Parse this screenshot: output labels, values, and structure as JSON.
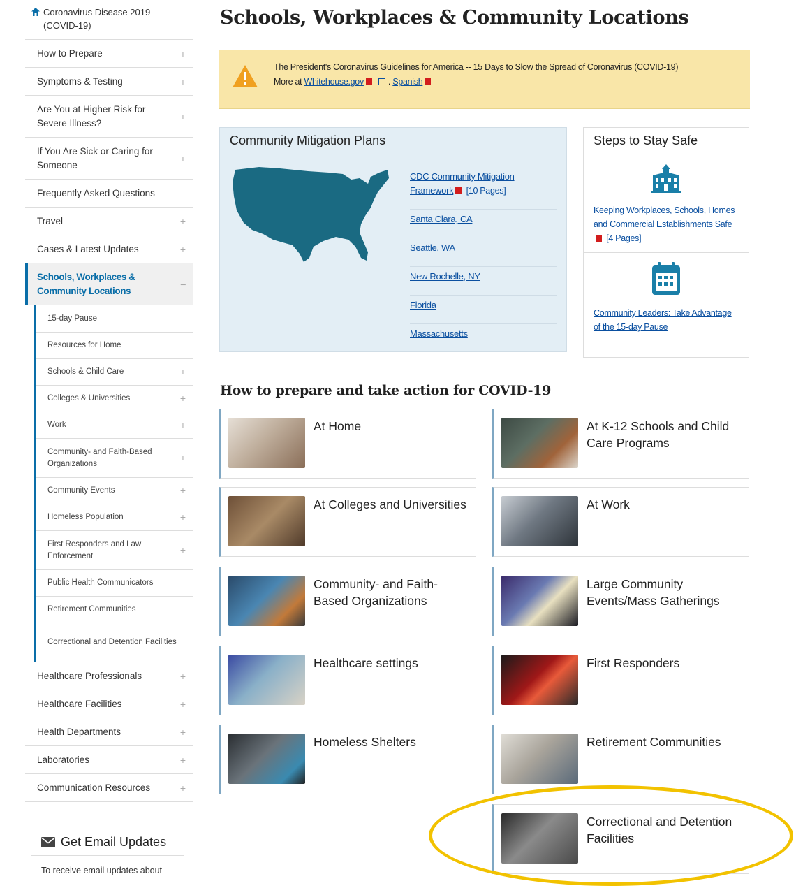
{
  "sidebar": {
    "home": "Coronavirus Disease 2019 (COVID-19)",
    "items": [
      {
        "label": "How to Prepare",
        "expand": "+"
      },
      {
        "label": "Symptoms & Testing",
        "expand": "+"
      },
      {
        "label": "Are You at Higher Risk for Severe Illness?",
        "expand": "+"
      },
      {
        "label": "If You Are Sick or Caring for Someone",
        "expand": "+"
      },
      {
        "label": "Frequently Asked Questions",
        "expand": ""
      },
      {
        "label": "Travel",
        "expand": "+"
      },
      {
        "label": "Cases & Latest Updates",
        "expand": "+"
      }
    ],
    "active": {
      "label": "Schools, Workplaces & Community Locations",
      "expand": "−"
    },
    "sub_items": [
      {
        "label": "15-day Pause",
        "expand": ""
      },
      {
        "label": "Resources for Home",
        "expand": ""
      },
      {
        "label": "Schools & Child Care",
        "expand": "+"
      },
      {
        "label": "Colleges & Universities",
        "expand": "+"
      },
      {
        "label": "Work",
        "expand": "+"
      },
      {
        "label": "Community- and Faith-Based Organizations",
        "expand": "+"
      },
      {
        "label": "Community Events",
        "expand": "+"
      },
      {
        "label": "Homeless Population",
        "expand": "+"
      },
      {
        "label": "First Responders and Law Enforcement",
        "expand": "+"
      },
      {
        "label": "Public Health Communicators",
        "expand": ""
      },
      {
        "label": "Retirement Communities",
        "expand": ""
      },
      {
        "label": "Correctional and Detention Facilities",
        "expand": ""
      }
    ],
    "items_after": [
      {
        "label": "Healthcare Professionals",
        "expand": "+"
      },
      {
        "label": "Healthcare Facilities",
        "expand": "+"
      },
      {
        "label": "Health Departments",
        "expand": "+"
      },
      {
        "label": "Laboratories",
        "expand": "+"
      },
      {
        "label": "Communication Resources",
        "expand": "+"
      }
    ],
    "email": {
      "title": "Get Email Updates",
      "body": "To receive email updates about"
    }
  },
  "page": {
    "title": "Schools, Workplaces & Community Locations"
  },
  "alert": {
    "line1": "The President's Coronavirus Guidelines for America -- 15 Days to Slow the Spread of Coronavirus (COVID-19)",
    "more_at": "More at",
    "link1": "Whitehouse.gov",
    "separator": ".",
    "link2": "Spanish"
  },
  "mitigation": {
    "title": "Community Mitigation Plans",
    "links": [
      {
        "label": "CDC Community Mitigation Framework",
        "meta": "[10 Pages]",
        "pdf": true
      },
      {
        "label": "Santa Clara, CA"
      },
      {
        "label": "Seattle, WA"
      },
      {
        "label": "New Rochelle, NY"
      },
      {
        "label": "Florida"
      },
      {
        "label": "Massachusetts"
      }
    ]
  },
  "safe": {
    "title": "Steps to Stay Safe",
    "blocks": [
      {
        "label": "Keeping Workplaces, Schools, Homes and Commercial Establishments Safe",
        "meta": "[4 Pages]",
        "icon": "building-icon"
      },
      {
        "label": "Community Leaders: Take Advantage of the 15-day Pause",
        "icon": "calendar-icon"
      }
    ]
  },
  "section": {
    "heading": "How to prepare and take action for COVID-19"
  },
  "cards": [
    {
      "label": "At Home",
      "color": "#c9bfb6"
    },
    {
      "label": "At K-12 Schools and Child Care Programs",
      "color": "#6e7d73"
    },
    {
      "label": "At Colleges and Universities",
      "color": "#8a6f55"
    },
    {
      "label": "At Work",
      "color": "#7d8690"
    },
    {
      "label": "Community- and Faith-Based Organizations",
      "color": "#4a6f8e"
    },
    {
      "label": "Large Community Events/Mass Gatherings",
      "color": "#2a3c48"
    },
    {
      "label": "Healthcare settings",
      "color": "#8e9fae"
    },
    {
      "label": "First Responders",
      "color": "#6e2a2a"
    },
    {
      "label": "Homeless Shelters",
      "color": "#5b636a"
    },
    {
      "label": "Retirement Communities",
      "color": "#a8a39b"
    },
    {
      "label": "Correctional and Detention Facilities",
      "color": "#5a5a5a"
    }
  ],
  "colors": {
    "accent": "#0a6ea8",
    "alert_bg": "#f9e6a8",
    "highlight_ring": "#f2c200",
    "map_fill": "#1a6a82"
  }
}
